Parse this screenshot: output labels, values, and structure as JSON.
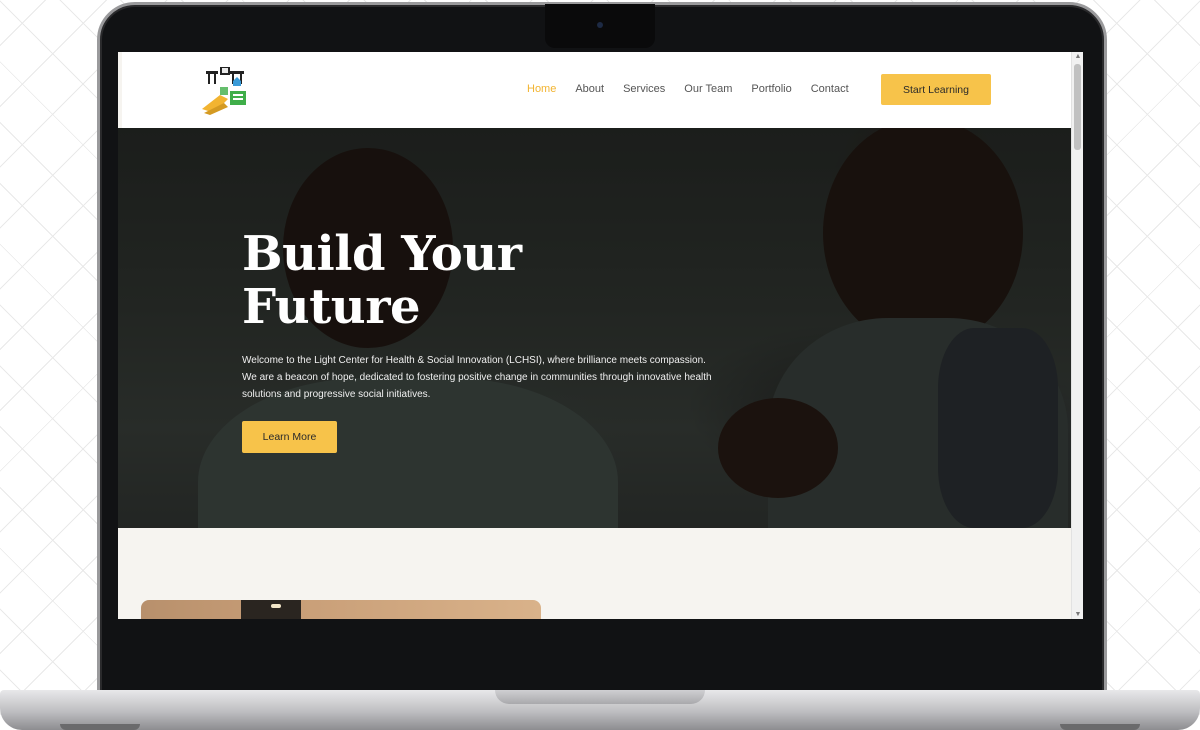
{
  "nav": {
    "items": [
      {
        "label": "Home",
        "active": true
      },
      {
        "label": "About",
        "active": false
      },
      {
        "label": "Services",
        "active": false
      },
      {
        "label": "Our Team",
        "active": false
      },
      {
        "label": "Portfolio",
        "active": false
      },
      {
        "label": "Contact",
        "active": false
      }
    ],
    "cta_label": "Start Learning"
  },
  "hero": {
    "title": "Build Your Future",
    "text": "Welcome to the Light Center for Health & Social Innovation (LCHSI), where brilliance meets compassion. We are a beacon of hope, dedicated to fostering positive change in communities through innovative health solutions and progressive social initiatives.",
    "button_label": "Learn More"
  },
  "colors": {
    "accent": "#f7c34a",
    "active_link": "#f2b431",
    "section_bg": "#f6f4f0"
  },
  "icons": {
    "logo": "lchsi-logo",
    "scroll_up": "chevron-up-icon",
    "scroll_down": "chevron-down-icon"
  }
}
